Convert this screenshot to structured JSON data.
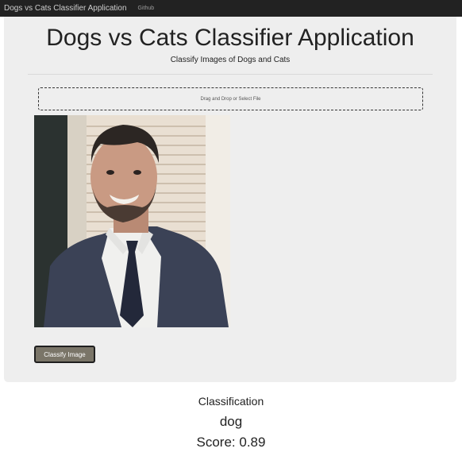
{
  "navbar": {
    "brand": "Dogs vs Cats Classifier Application",
    "links": [
      "Github"
    ]
  },
  "header": {
    "title": "Dogs vs Cats Classifier Application",
    "subtitle": "Classify Images of Dogs and Cats"
  },
  "upload": {
    "prompt": "Drag and Drop or Select File"
  },
  "preview": {
    "description": "uploaded photo"
  },
  "actions": {
    "classify_label": "Classify Image"
  },
  "result": {
    "heading": "Classification",
    "label": "dog",
    "score_text": "Score: 0.89"
  },
  "colors": {
    "navbar_bg": "#222222",
    "panel_bg": "#eeeeee",
    "button_bg": "#7a7568"
  }
}
